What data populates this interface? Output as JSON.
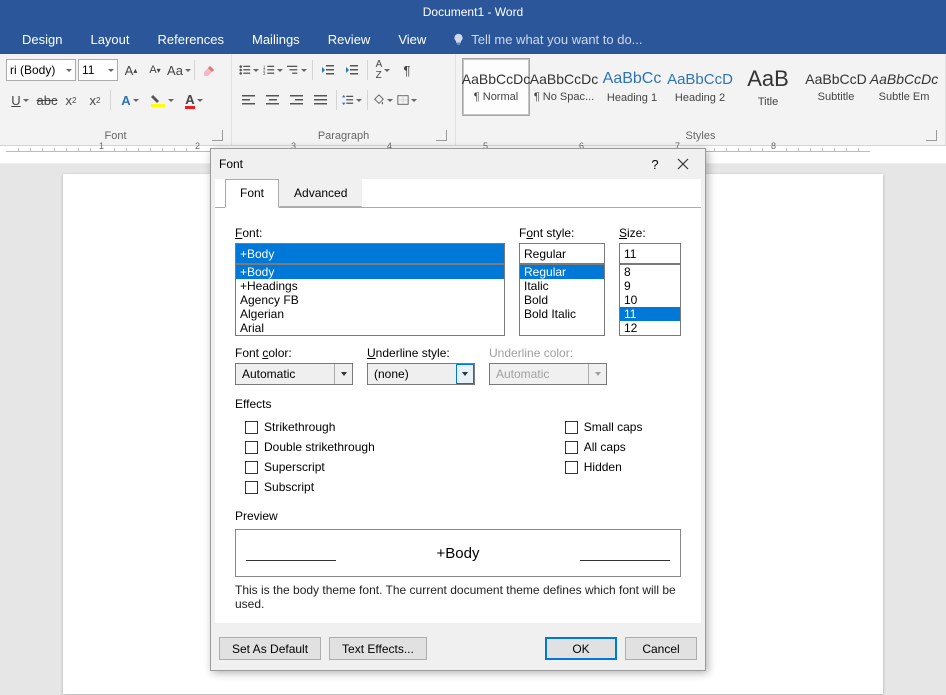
{
  "titlebar": "Document1 - Word",
  "tabs": {
    "design": "Design",
    "layout": "Layout",
    "references": "References",
    "mailings": "Mailings",
    "review": "Review",
    "view": "View"
  },
  "tellme": "Tell me what you want to do...",
  "ribbon": {
    "font_group": "Font",
    "paragraph_group": "Paragraph",
    "styles_group": "Styles",
    "font_name": "ri (Body)",
    "font_size": "11",
    "styles": [
      {
        "sample": "AaBbCcDc",
        "name": "¶ Normal",
        "selected": true
      },
      {
        "sample": "AaBbCcDc",
        "name": "¶ No Spac..."
      },
      {
        "sample": "AaBbCc",
        "name": "Heading 1",
        "blue": true,
        "size": "16px"
      },
      {
        "sample": "AaBbCcD",
        "name": "Heading 2",
        "blue": true,
        "size": "15px"
      },
      {
        "sample": "AaB",
        "name": "Title",
        "big": true
      },
      {
        "sample": "AaBbCcD",
        "name": "Subtitle"
      },
      {
        "sample": "AaBbCcDc",
        "name": "Subtle Em",
        "italic": true
      }
    ]
  },
  "dialog": {
    "title": "Font",
    "tab_font": "Font",
    "tab_advanced": "Advanced",
    "font_label": "Font:",
    "font_value": "+Body",
    "font_list": [
      "+Body",
      "+Headings",
      "Agency FB",
      "Algerian",
      "Arial"
    ],
    "style_label": "Font style:",
    "style_value": "Regular",
    "style_list": [
      "Regular",
      "Italic",
      "Bold",
      "Bold Italic"
    ],
    "size_label": "Size:",
    "size_value": "11",
    "size_list": [
      "8",
      "9",
      "10",
      "11",
      "12"
    ],
    "fontcolor_label": "Font color:",
    "fontcolor_value": "Automatic",
    "ulstyle_label": "Underline style:",
    "ulstyle_value": "(none)",
    "ulcolor_label": "Underline color:",
    "ulcolor_value": "Automatic",
    "effects_label": "Effects",
    "fx": {
      "strike": "Strikethrough",
      "dstrike": "Double strikethrough",
      "super": "Superscript",
      "sub": "Subscript",
      "smallcaps": "Small caps",
      "allcaps": "All caps",
      "hidden": "Hidden"
    },
    "preview_label": "Preview",
    "preview_text": "+Body",
    "preview_desc": "This is the body theme font. The current document theme defines which font will be used.",
    "btn_default": "Set As Default",
    "btn_texteffects": "Text Effects...",
    "btn_ok": "OK",
    "btn_cancel": "Cancel"
  },
  "ruler": [
    "1",
    "",
    "",
    "",
    "",
    "5",
    "6",
    "7"
  ]
}
